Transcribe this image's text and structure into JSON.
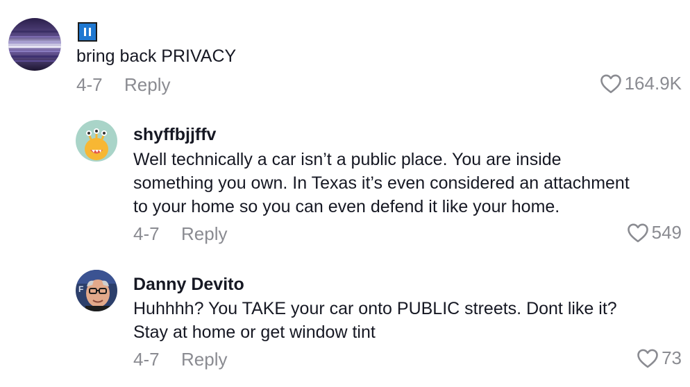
{
  "comments": [
    {
      "username": "",
      "badge_icon": "pause-emoji-icon",
      "text": "bring back PRIVACY",
      "date": "4-7",
      "reply_label": "Reply",
      "likes": "164.9K"
    },
    {
      "username": "shyffbjjffv",
      "text_lines": [
        "Well technically a car isn’t a public place. You are inside",
        "something you own. In Texas it’s even considered an attachment",
        "to your home so you can even defend it like your home."
      ],
      "date": "4-7",
      "reply_label": "Reply",
      "likes": "549"
    },
    {
      "username": "Danny Devito",
      "text_lines": [
        "Huhhhh? You TAKE your car onto PUBLIC streets. Dont like it?",
        "Stay at home or get window tint"
      ],
      "date": "4-7",
      "reply_label": "Reply",
      "likes": "73"
    }
  ],
  "colors": {
    "text_primary": "#161823",
    "text_secondary": "#8a8b91",
    "badge_blue": "#1f78d1"
  }
}
